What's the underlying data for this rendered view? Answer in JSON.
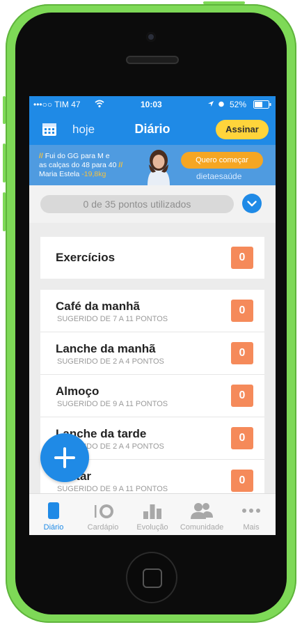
{
  "status": {
    "carrier": "•••○○ TIM 47",
    "time": "10:03",
    "battery": "52%"
  },
  "nav": {
    "hoje": "hoje",
    "title": "Diário",
    "assinar": "Assinar"
  },
  "banner": {
    "quote_line1": "Fui do GG para M e",
    "quote_line2": "as calças do 48 para 40",
    "person": "Maria Estela",
    "weight": "-19,8kg",
    "cta": "Quero começar",
    "brand": "dietaesaúde"
  },
  "points": {
    "text": "0 de 35 pontos utilizados"
  },
  "exercise": {
    "label": "Exercícios",
    "value": "0"
  },
  "meals": [
    {
      "label": "Café da manhã",
      "sub": "SUGERIDO DE 7 A 11 PONTOS",
      "value": "0"
    },
    {
      "label": "Lanche da manhã",
      "sub": "SUGERIDO DE 2 A 4 PONTOS",
      "value": "0"
    },
    {
      "label": "Almoço",
      "sub": "SUGERIDO DE 9 A 11 PONTOS",
      "value": "0"
    },
    {
      "label": "Lanche da tarde",
      "sub": "SUGERIDO DE 2 A 4 PONTOS",
      "value": "0"
    },
    {
      "label": "Jantar",
      "sub": "SUGERIDO DE 9 A 11 PONTOS",
      "value": "0"
    }
  ],
  "tabs": [
    {
      "label": "Diário",
      "icon": "journal-icon"
    },
    {
      "label": "Cardápio",
      "icon": "plate-icon"
    },
    {
      "label": "Evolução",
      "icon": "bar-chart-icon"
    },
    {
      "label": "Comunidade",
      "icon": "people-icon"
    },
    {
      "label": "Mais",
      "icon": "more-icon"
    }
  ],
  "colors": {
    "primary": "#1f8ae6",
    "accent": "#ffd43b",
    "badge": "#f58a5a",
    "phone": "#7ed957"
  }
}
